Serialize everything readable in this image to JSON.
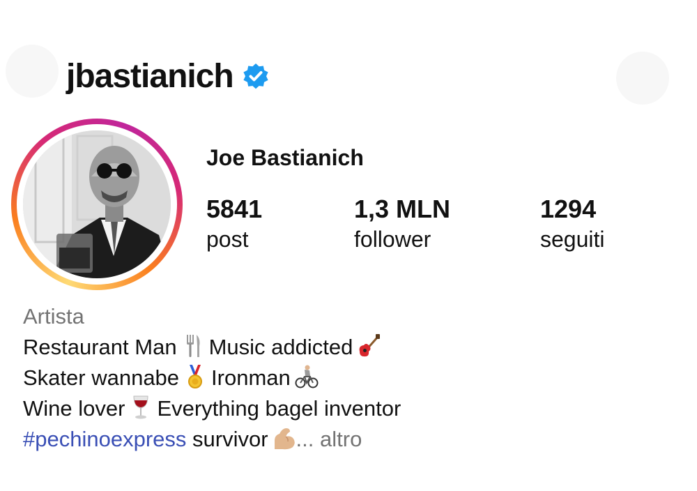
{
  "profile": {
    "username": "jbastianich",
    "verified": true,
    "full_name": "Joe Bastianich",
    "stats": {
      "posts": {
        "value": "5841",
        "label": "post"
      },
      "followers": {
        "value": "1,3 MLN",
        "label": "follower"
      },
      "following": {
        "value": "1294",
        "label": "seguiti"
      }
    },
    "bio": {
      "category": "Artista",
      "line1_a": "Restaurant Man",
      "line1_b": "Music addicted",
      "line2_a": "Skater wannabe",
      "line2_b": "Ironman",
      "line3_a": "Wine lover",
      "line3_b": "Everything bagel inventor",
      "hashtag": "#pechinoexpress",
      "line4_b": "survivor",
      "ellipsis": "...",
      "more_label": "altro"
    }
  },
  "icons": {
    "verified": "verified-badge-icon",
    "emojis": [
      "fork-knife-icon",
      "guitar-icon",
      "medal-icon",
      "cyclist-icon",
      "wine-glass-icon",
      "flexed-bicep-icon"
    ]
  },
  "colors": {
    "verified_blue": "#1d9bf0",
    "hashtag": "#3a4fb5",
    "secondary_text": "#737373"
  }
}
